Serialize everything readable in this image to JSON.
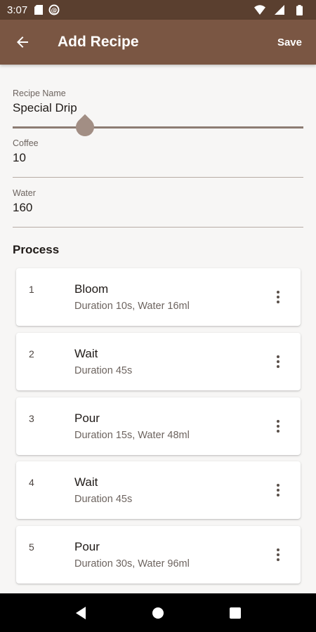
{
  "status_bar": {
    "time": "3:07",
    "icons": [
      "sd-card-icon",
      "sync-icon",
      "wifi-icon",
      "signal-icon",
      "battery-icon"
    ]
  },
  "app_bar": {
    "title": "Add Recipe",
    "back_icon": "arrow-back-icon",
    "save_label": "Save",
    "color": "#7a5643"
  },
  "form": {
    "recipe_name": {
      "label": "Recipe Name",
      "value": "Special Drip"
    },
    "coffee": {
      "label": "Coffee",
      "value": "10"
    },
    "water": {
      "label": "Water",
      "value": "160"
    }
  },
  "process": {
    "title": "Process",
    "steps": [
      {
        "number": "1",
        "name": "Bloom",
        "detail": "Duration 10s, Water 16ml"
      },
      {
        "number": "2",
        "name": "Wait",
        "detail": "Duration 45s"
      },
      {
        "number": "3",
        "name": "Pour",
        "detail": "Duration 15s, Water 48ml"
      },
      {
        "number": "4",
        "name": "Wait",
        "detail": "Duration 45s"
      },
      {
        "number": "5",
        "name": "Pour",
        "detail": "Duration 30s, Water 96ml"
      }
    ]
  },
  "nav_bar": {
    "icons": [
      "back-triangle-icon",
      "home-circle-icon",
      "recents-square-icon"
    ]
  }
}
